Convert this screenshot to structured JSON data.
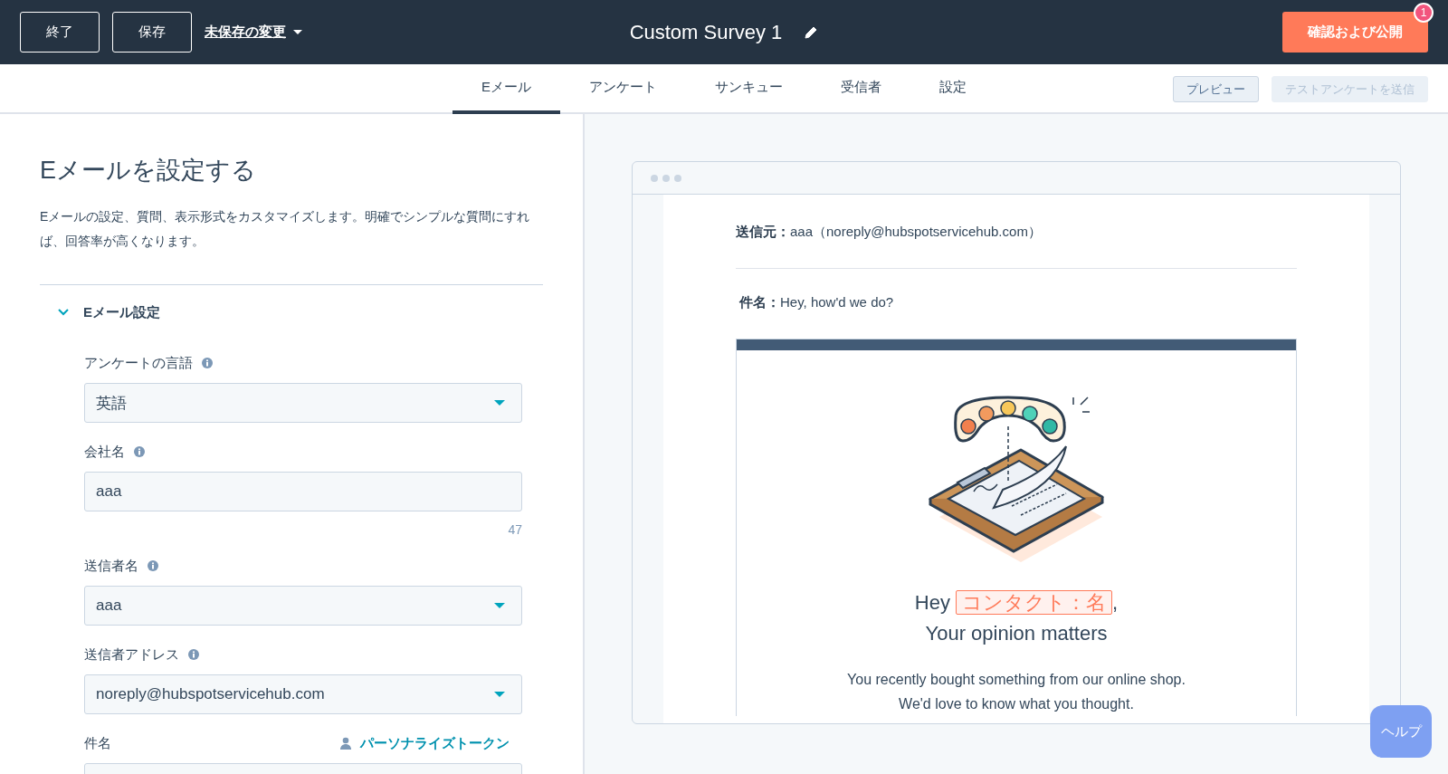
{
  "top_bar": {
    "exit_button": "終了",
    "save_button": "保存",
    "unsaved_menu": "未保存の変更",
    "title": "Custom Survey 1",
    "publish_button": "確認および公開",
    "notification_count": "1"
  },
  "tabs": [
    {
      "label": "Eメール",
      "selected": true
    },
    {
      "label": "アンケート",
      "selected": false
    },
    {
      "label": "サンキュー",
      "selected": false
    },
    {
      "label": "受信者",
      "selected": false
    },
    {
      "label": "設定",
      "selected": false
    }
  ],
  "tab_actions": [
    {
      "label": "プレビュー",
      "disabled": false
    },
    {
      "label": "テストアンケートを送信",
      "disabled": true
    }
  ],
  "settings_panel": {
    "heading": "Eメールを設定する",
    "description": "Eメールの設定、質問、表示形式をカスタマイズします。明確でシンプルな質問にすれば、回答率が高くなります。",
    "section": {
      "title": "Eメール設定",
      "expanded": true
    },
    "fields": [
      {
        "kind": "select",
        "label": "アンケートの言語",
        "info": true,
        "value": "英語"
      },
      {
        "kind": "text",
        "label": "会社名",
        "info": true,
        "value": "aaa",
        "counter": "47"
      },
      {
        "kind": "select",
        "label": "送信者名",
        "info": true,
        "value": "aaa"
      },
      {
        "kind": "select",
        "label": "送信者アドレス",
        "info": true,
        "value": "noreply@hubspotservicehub.com"
      },
      {
        "kind": "text",
        "label": "件名",
        "info": false,
        "token_link": "パーソナライズトークン"
      }
    ]
  },
  "preview": {
    "from_label": "送信元：",
    "from_value": "aaa（noreply@hubspotservicehub.com）",
    "subject_label": "件名：",
    "subject_value": "Hey, how'd we do?",
    "greeting": "Hey",
    "token": "コンタクト：名",
    "greeting_end": ",",
    "headline": "Your opinion matters",
    "body": "You recently bought something from our online shop. We'd love to know what you thought."
  },
  "help_button": "ヘルプ"
}
